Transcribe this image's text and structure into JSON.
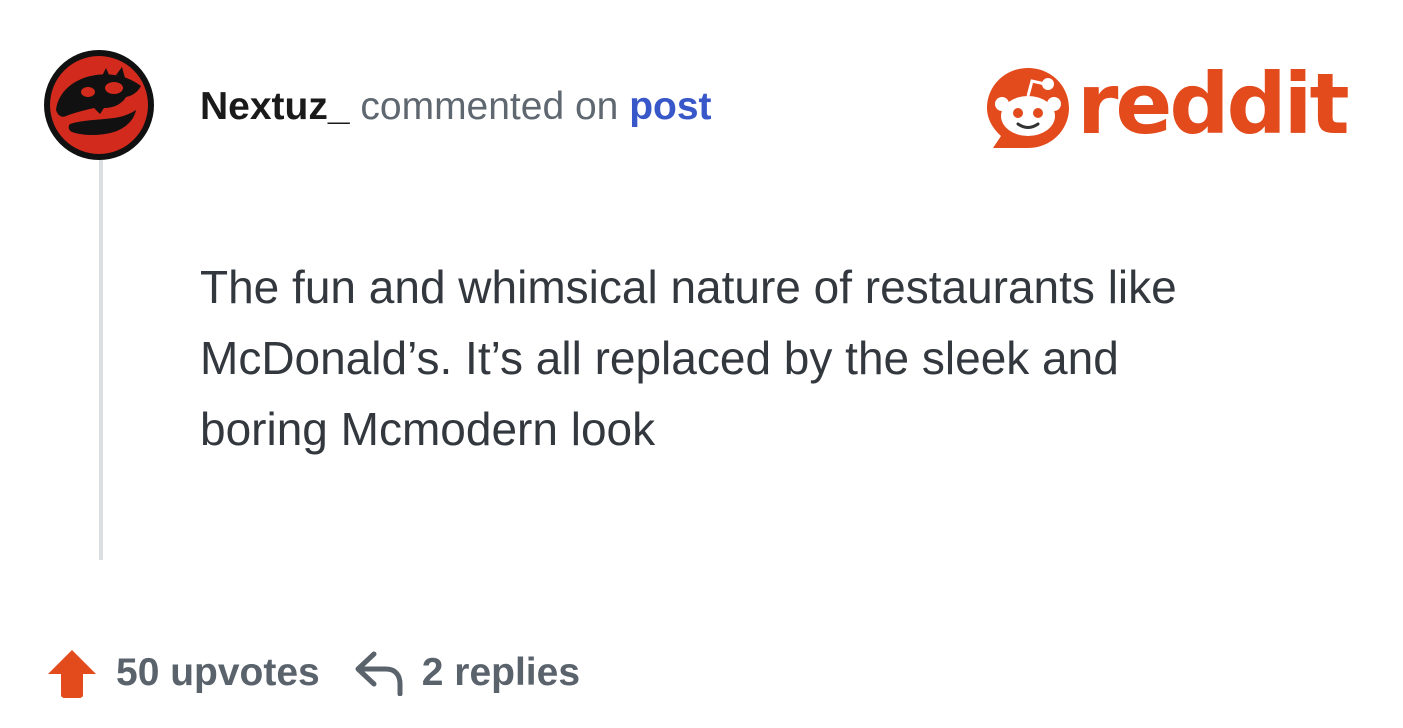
{
  "comment": {
    "author": "Nextuz_",
    "action_text": "commented on",
    "target_link": "post",
    "body_lines": [
      "The fun and whimsical nature of restaurants like",
      "McDonald’s. It’s all replaced by the sleek and",
      "boring Mcmodern look"
    ]
  },
  "brand": {
    "wordmark": "reddit",
    "color": "#e34a1c"
  },
  "stats": {
    "upvotes": "50 upvotes",
    "replies": "2 replies"
  },
  "icons": {
    "avatar": "dinosaur-skull-avatar",
    "upvote": "upvote-arrow-icon",
    "reply": "reply-arrow-icon",
    "logo": "reddit-snoo-icon"
  },
  "colors": {
    "upvote": "#e34a1c",
    "link": "#3857c9",
    "avatar_red": "#d32a1e"
  }
}
